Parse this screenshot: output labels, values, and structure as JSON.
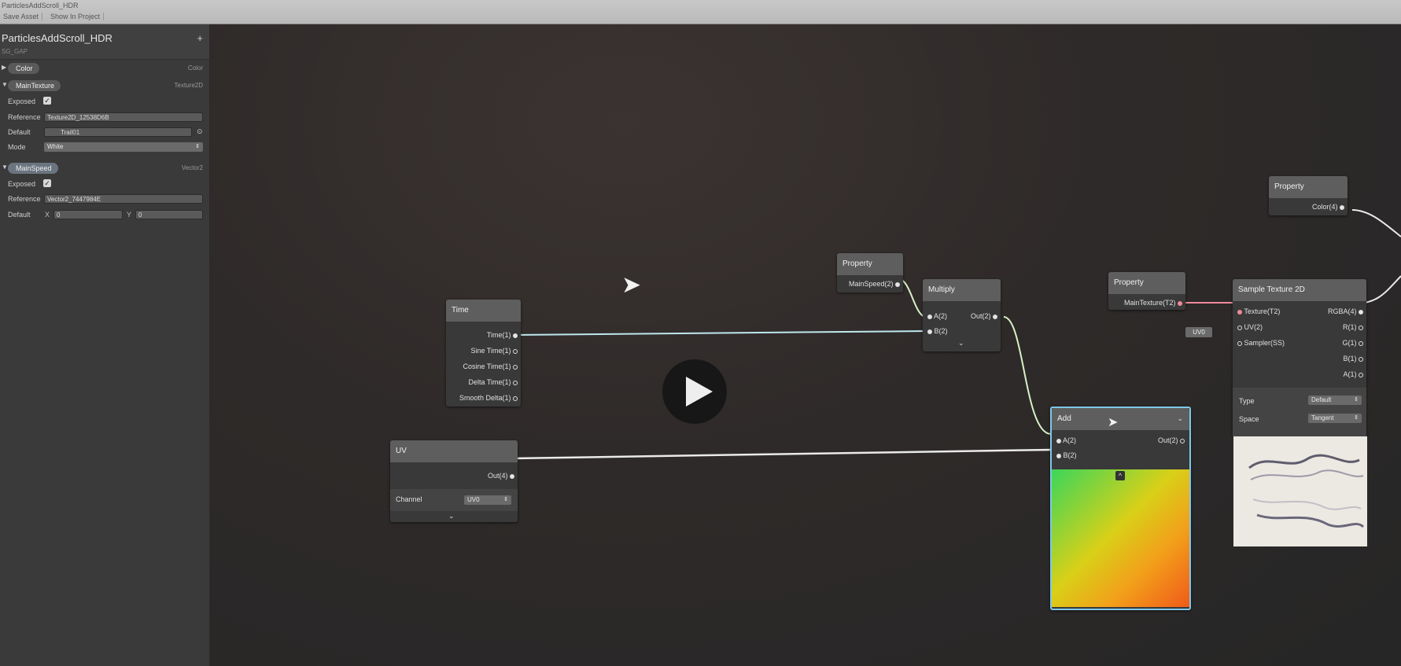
{
  "window": {
    "title": "ParticlesAddScroll_HDR",
    "toolbar": {
      "save": "Save Asset",
      "show": "Show In Project"
    }
  },
  "blackboard": {
    "title": "ParticlesAddScroll_HDR",
    "subtitle": "SG_GAP",
    "add": "+",
    "properties": [
      {
        "name": "Color",
        "type": "Color"
      },
      {
        "name": "MainTexture",
        "type": "Texture2D",
        "exposed_label": "Exposed",
        "reference_label": "Reference",
        "reference": "Texture2D_12538D6B",
        "default_label": "Default",
        "default": "Trail01",
        "mode_label": "Mode",
        "mode": "White"
      },
      {
        "name": "MainSpeed",
        "type": "Vector2",
        "exposed_label": "Exposed",
        "reference_label": "Reference",
        "reference": "Vector2_7447984E",
        "default_label": "Default",
        "x_label": "X",
        "x": "0",
        "y_label": "Y",
        "y": "0"
      }
    ]
  },
  "nodes": {
    "time": {
      "title": "Time",
      "outputs": [
        "Time(1)",
        "Sine Time(1)",
        "Cosine Time(1)",
        "Delta Time(1)",
        "Smooth Delta(1)"
      ]
    },
    "uv": {
      "title": "UV",
      "output": "Out(4)",
      "channel_label": "Channel",
      "channel": "UV0"
    },
    "prop_speed": {
      "title": "Property",
      "output": "MainSpeed(2)"
    },
    "multiply": {
      "title": "Multiply",
      "in_a": "A(2)",
      "in_b": "B(2)",
      "out": "Out(2)"
    },
    "add": {
      "title": "Add",
      "in_a": "A(2)",
      "in_b": "B(2)",
      "out": "Out(2)"
    },
    "prop_tex": {
      "title": "Property",
      "output": "MainTexture(T2)"
    },
    "uv_chip": "UV0",
    "sample": {
      "title": "Sample Texture 2D",
      "in_tex": "Texture(T2)",
      "in_uv": "UV(2)",
      "in_sampler": "Sampler(SS)",
      "out_rgba": "RGBA(4)",
      "out_r": "R(1)",
      "out_g": "G(1)",
      "out_b": "B(1)",
      "out_a": "A(1)",
      "type_label": "Type",
      "type": "Default",
      "space_label": "Space",
      "space": "Tangent"
    },
    "prop_color": {
      "title": "Property",
      "output": "Color(4)"
    }
  }
}
